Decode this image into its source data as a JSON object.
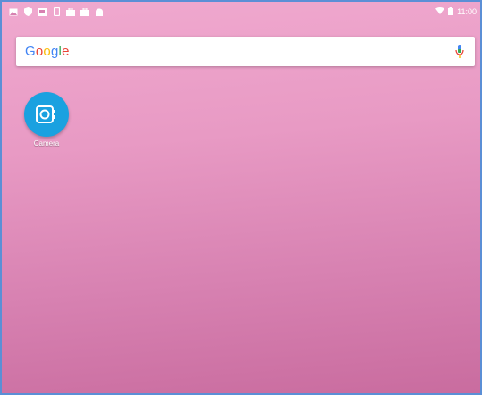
{
  "status_bar": {
    "notification_icons": [
      "gallery-icon",
      "shield-icon",
      "image-icon",
      "phone-icon",
      "briefcase-icon",
      "briefcase-icon",
      "android-icon"
    ],
    "time": "11:00"
  },
  "search": {
    "logo_text": "Google"
  },
  "apps": [
    {
      "label": "Camera"
    }
  ],
  "colors": {
    "wallpaper_top": "#f0a9cf",
    "wallpaper_bottom": "#c96c9f",
    "app_icon_bg": "#1aa1e0"
  }
}
